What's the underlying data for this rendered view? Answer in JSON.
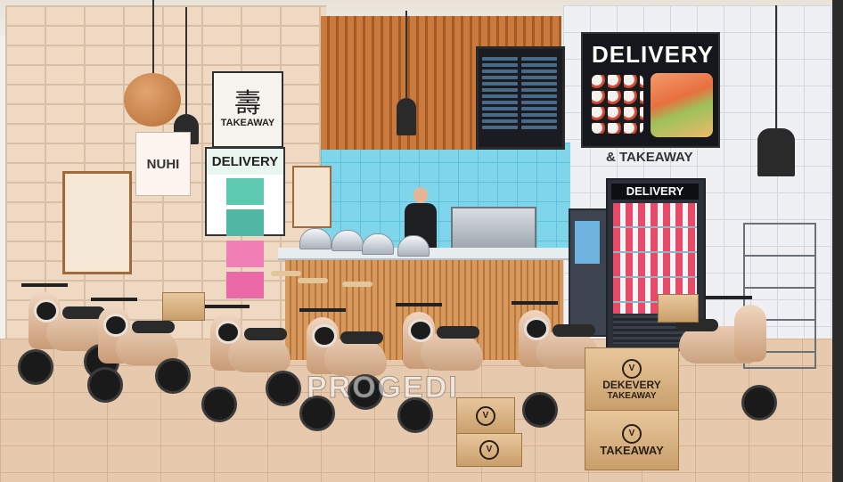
{
  "signs": {
    "takeaway_sign": "TAKEAWAY",
    "nuhi_sign": "NUHI",
    "delivery_small": "DELIVERY",
    "delivery_big": "DELIVERY",
    "takeaway_tagline": "& TAKEAWAY",
    "fridge_header": "DELIVERY"
  },
  "boxes": {
    "box_big_top": "DEKEVERY",
    "box_big_top_side": "TAKEAWAY",
    "box_big_bottom": "TAKEAWAY"
  },
  "watermark": "PROGEDI",
  "colors": {
    "wood": "#c97a3c",
    "tile_blue": "#7fd6ea",
    "scooter_beige": "#e9cbb2",
    "sign_dark": "#15171c"
  }
}
